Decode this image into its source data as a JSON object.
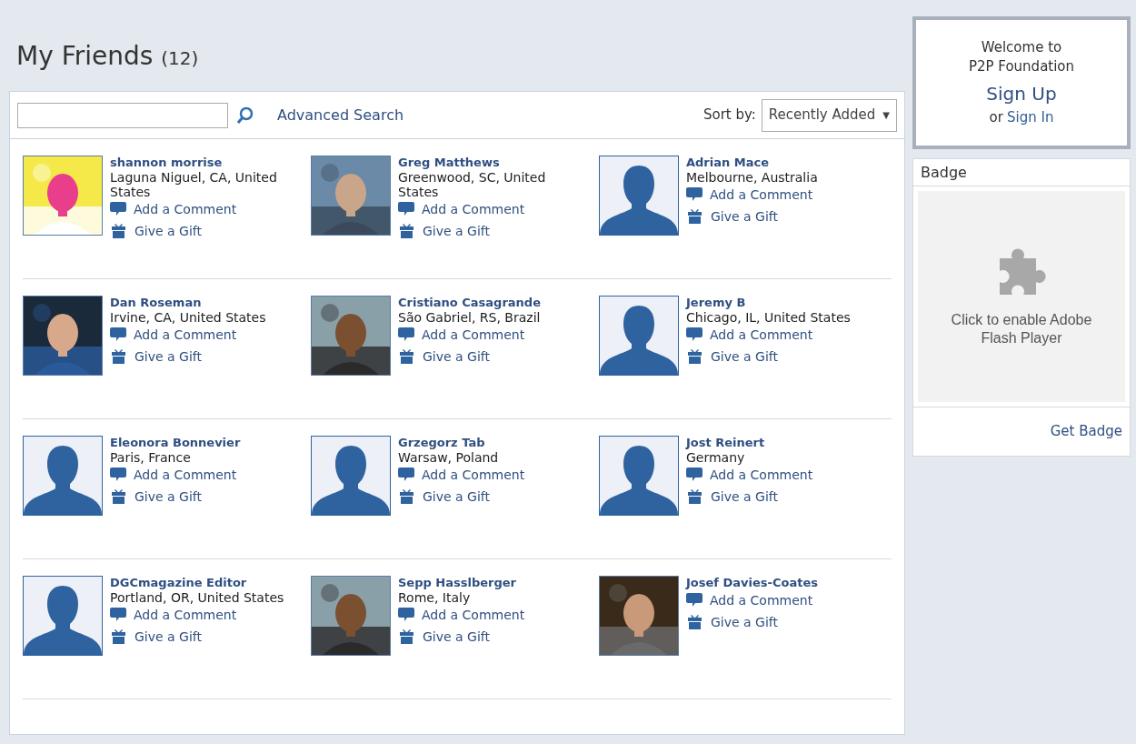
{
  "page_title": {
    "title": "My Friends",
    "count": "(12)"
  },
  "toolbar": {
    "advanced_search": "Advanced Search",
    "sort_label": "Sort by:",
    "sort_value": "Recently Added",
    "sort_caret": "▼"
  },
  "friends": [
    {
      "name": "shannon morrise",
      "location": "Laguna Niguel, CA, United States",
      "kind": "picture",
      "comment": "Add a Comment",
      "gift": "Give a Gift"
    },
    {
      "name": "Greg Matthews",
      "location": "Greenwood, SC, United States",
      "kind": "picture",
      "comment": "Add a Comment",
      "gift": "Give a Gift"
    },
    {
      "name": "Adrian Mace",
      "location": "Melbourne, Australia",
      "kind": "silhouette",
      "comment": "Add a Comment",
      "gift": "Give a Gift"
    },
    {
      "name": "Dan Roseman",
      "location": "Irvine, CA, United States",
      "kind": "picture",
      "comment": "Add a Comment",
      "gift": "Give a Gift"
    },
    {
      "name": "Cristiano Casagrande",
      "location": "São Gabriel, RS, Brazil",
      "kind": "picture",
      "comment": "Add a Comment",
      "gift": "Give a Gift"
    },
    {
      "name": "Jeremy B",
      "location": "Chicago, IL, United States",
      "kind": "silhouette",
      "comment": "Add a Comment",
      "gift": "Give a Gift"
    },
    {
      "name": "Eleonora Bonnevier",
      "location": "Paris, France",
      "kind": "silhouette",
      "comment": "Add a Comment",
      "gift": "Give a Gift"
    },
    {
      "name": "Grzegorz Tab",
      "location": "Warsaw, Poland",
      "kind": "silhouette",
      "comment": "Add a Comment",
      "gift": "Give a Gift"
    },
    {
      "name": "Jost Reinert",
      "location": "Germany",
      "kind": "silhouette",
      "comment": "Add a Comment",
      "gift": "Give a Gift"
    },
    {
      "name": "DGCmagazine Editor",
      "location": "Portland, OR, United States",
      "kind": "silhouette",
      "comment": "Add a Comment",
      "gift": "Give a Gift"
    },
    {
      "name": "Sepp Hasslberger",
      "location": "Rome, Italy",
      "kind": "picture",
      "comment": "Add a Comment",
      "gift": "Give a Gift"
    },
    {
      "name": "Josef Davies-Coates",
      "kind": "picture",
      "comment": "Add a Comment",
      "gift": "Give a Gift"
    }
  ],
  "welcome_box": {
    "greeting": "Welcome to",
    "site": "P2P Foundation",
    "sign_up": "Sign Up",
    "or": "or",
    "sign_in": "Sign In"
  },
  "badge_box": {
    "title": "Badge",
    "plugin_message": "Click to enable Adobe Flash Player",
    "get_badge": "Get Badge"
  }
}
